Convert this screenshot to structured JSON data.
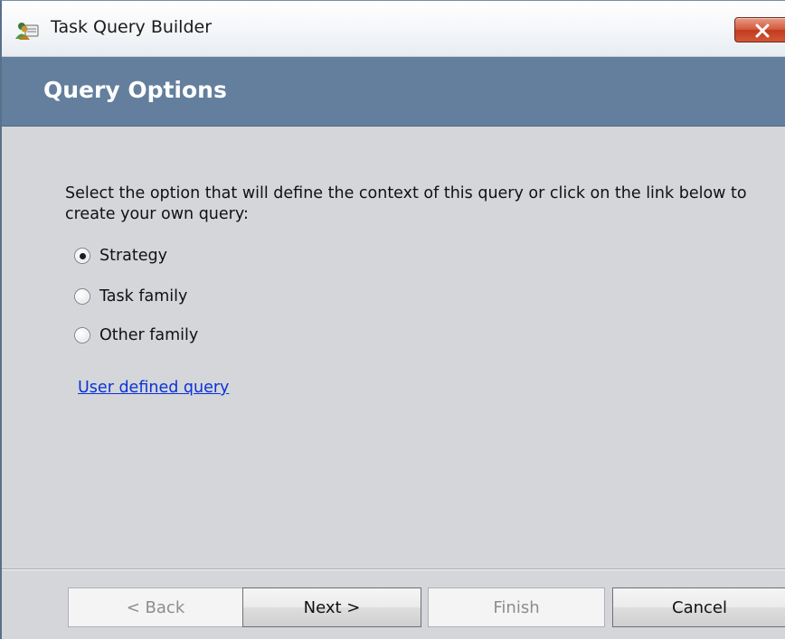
{
  "window": {
    "title": "Task Query Builder",
    "app_icon": "users-icon",
    "close_icon": "close-icon"
  },
  "header": {
    "title": "Query Options"
  },
  "content": {
    "instructions": "Select the option that will define the context of this query or click on the link below to create your own query:",
    "options": [
      {
        "label": "Strategy",
        "checked": true
      },
      {
        "label": "Task family",
        "checked": false
      },
      {
        "label": "Other family",
        "checked": false
      }
    ],
    "link_text": "User defined query"
  },
  "footer": {
    "back_label": "< Back",
    "next_label": "Next >",
    "finish_label": "Finish",
    "cancel_label": "Cancel"
  },
  "colors": {
    "header_band": "#637f9d",
    "link": "#0a33d6",
    "close_button": "#c23b1e"
  }
}
